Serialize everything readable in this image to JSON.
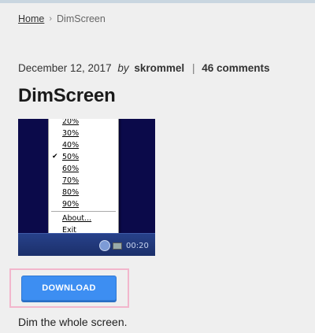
{
  "breadcrumb": {
    "home": "Home",
    "separator": "›",
    "current": "DimScreen"
  },
  "post": {
    "date": "December 12, 2017",
    "by": "by",
    "author": "skrommel",
    "divider": "|",
    "comments": "46 comments",
    "title": "DimScreen",
    "description": "Dim the whole screen."
  },
  "screenshot": {
    "menu": {
      "items": [
        {
          "label": "20%",
          "checked": false
        },
        {
          "label": "30%",
          "checked": false
        },
        {
          "label": "40%",
          "checked": false
        },
        {
          "label": "50%",
          "checked": true
        },
        {
          "label": "60%",
          "checked": false
        },
        {
          "label": "70%",
          "checked": false
        },
        {
          "label": "80%",
          "checked": false
        },
        {
          "label": "90%",
          "checked": false
        },
        {
          "label": "About...",
          "checked": false
        },
        {
          "label": "Exit",
          "checked": false
        }
      ],
      "check_glyph": "✔"
    },
    "clock": "00:20"
  },
  "download": {
    "label": "DOWNLOAD"
  },
  "colors": {
    "button": "#3d8ef2",
    "highlight_frame": "#f2b6cc",
    "screenshot_bg": "#0b0a4a"
  }
}
